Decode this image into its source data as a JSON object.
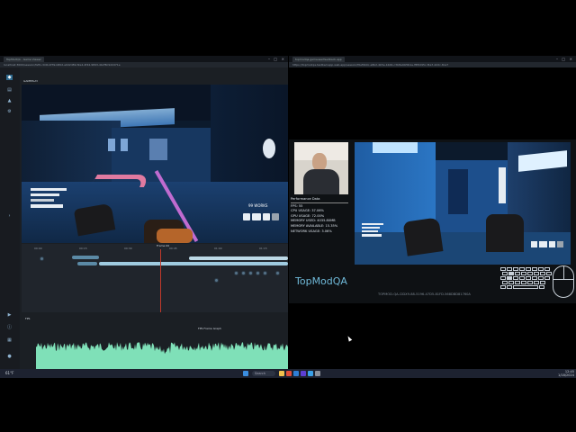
{
  "left_window": {
    "tab_title": "TopModQA - Game Viewer",
    "address": "localhost:3000/session/fef0-c0d0-4f39-b80d-e9d2d89-f2e4-4f44-9893-4b2f8c9d2d71e",
    "section_label": "GAMEPLAY",
    "stats_right": "99 WORKS"
  },
  "timeline": {
    "ticks": [
      "00:00",
      "00:15",
      "00:30",
      "00:45",
      "01:00",
      "01:15"
    ],
    "track_label": "Frame 00"
  },
  "graph": {
    "panel_label": "FPS",
    "legend": "FPS Frame Graph"
  },
  "right_window": {
    "tab_title": "topmodqa.gameuserfeedback.app",
    "address": "https://topmodqa-testbed-app.web.app/session/f0ef9b0c-a8b2-4b5e-bb00-c3b8a4bf0b1e-f8f0d95c-f4a7-4d2c-8ca7"
  },
  "perf": {
    "title": "Performance Data",
    "fps": "FPS: 55",
    "cpu": "CPU USAGE: 37.06%",
    "gpu": "GPU USAGE: 72.00%",
    "mem_used": "MEMORY USED: 4035.80MB",
    "mem_avail": "MEMORY AVAILABLE: 15.35%",
    "net": "NETWORK USAGE: 3.06%"
  },
  "brand": "TopModQA",
  "session_id": "TOPMOD-QA-CIDX9-88-5196-47D5-81FD-568DBD81760A",
  "taskbar": {
    "search": "Search",
    "weather": "61°F",
    "time": "12:45",
    "date": "1/18/2024"
  },
  "colors": {
    "accent": "#6fb9d8",
    "playhead": "#c0392b",
    "graph_fill": "#7fe0b8",
    "clip": "#9fcbe0"
  }
}
